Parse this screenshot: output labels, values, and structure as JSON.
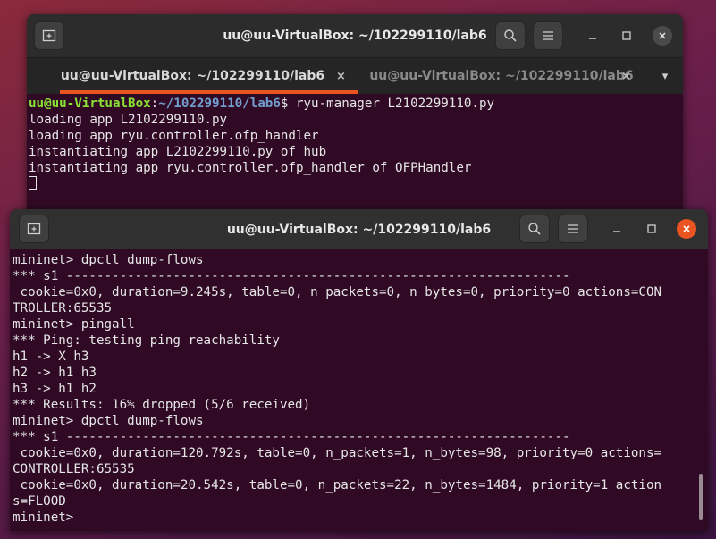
{
  "window_back": {
    "title": "uu@uu-VirtualBox: ~/102299110/lab6",
    "tabs": [
      {
        "label": "uu@uu-VirtualBox: ~/102299110/lab6",
        "close": "×",
        "active": true
      },
      {
        "label": "uu@uu-VirtualBox: ~/102299110/lab6",
        "close": "×",
        "active": false
      }
    ],
    "tab_menu_icon": "▾",
    "prompt_user": "uu@uu-VirtualBox",
    "prompt_sep": ":",
    "prompt_path": "~/102299110/lab6",
    "prompt_cmd": "$ ryu-manager L2102299110.py",
    "lines": [
      "loading app L2102299110.py",
      "loading app ryu.controller.ofp_handler",
      "instantiating app L2102299110.py of hub",
      "instantiating app ryu.controller.ofp_handler of OFPHandler"
    ]
  },
  "window_front": {
    "title": "uu@uu-VirtualBox: ~/102299110/lab6",
    "lines": [
      "mininet> dpctl dump-flows",
      "*** s1 ------------------------------------------------------------------",
      " cookie=0x0, duration=9.245s, table=0, n_packets=0, n_bytes=0, priority=0 actions=CON",
      "TROLLER:65535",
      "mininet> pingall",
      "*** Ping: testing ping reachability",
      "h1 -> X h3",
      "h2 -> h1 h3",
      "h3 -> h1 h2",
      "*** Results: 16% dropped (5/6 received)",
      "mininet> dpctl dump-flows",
      "*** s1 ------------------------------------------------------------------",
      " cookie=0x0, duration=120.792s, table=0, n_packets=1, n_bytes=98, priority=0 actions=",
      "CONTROLLER:65535",
      " cookie=0x0, duration=20.542s, table=0, n_packets=22, n_bytes=1484, priority=1 action",
      "s=FLOOD",
      "mininet>"
    ]
  },
  "colors": {
    "terminal_bg": "#300a24",
    "prompt_user": "#8ae234",
    "prompt_path": "#729fcf",
    "close_active": "#e95420",
    "tab_underline": "#e95420"
  },
  "icons": {
    "new_tab": "new-tab-icon",
    "search": "search-icon",
    "menu": "hamburger-menu-icon",
    "minimize": "minimize-icon",
    "maximize": "maximize-icon",
    "close": "close-icon"
  }
}
